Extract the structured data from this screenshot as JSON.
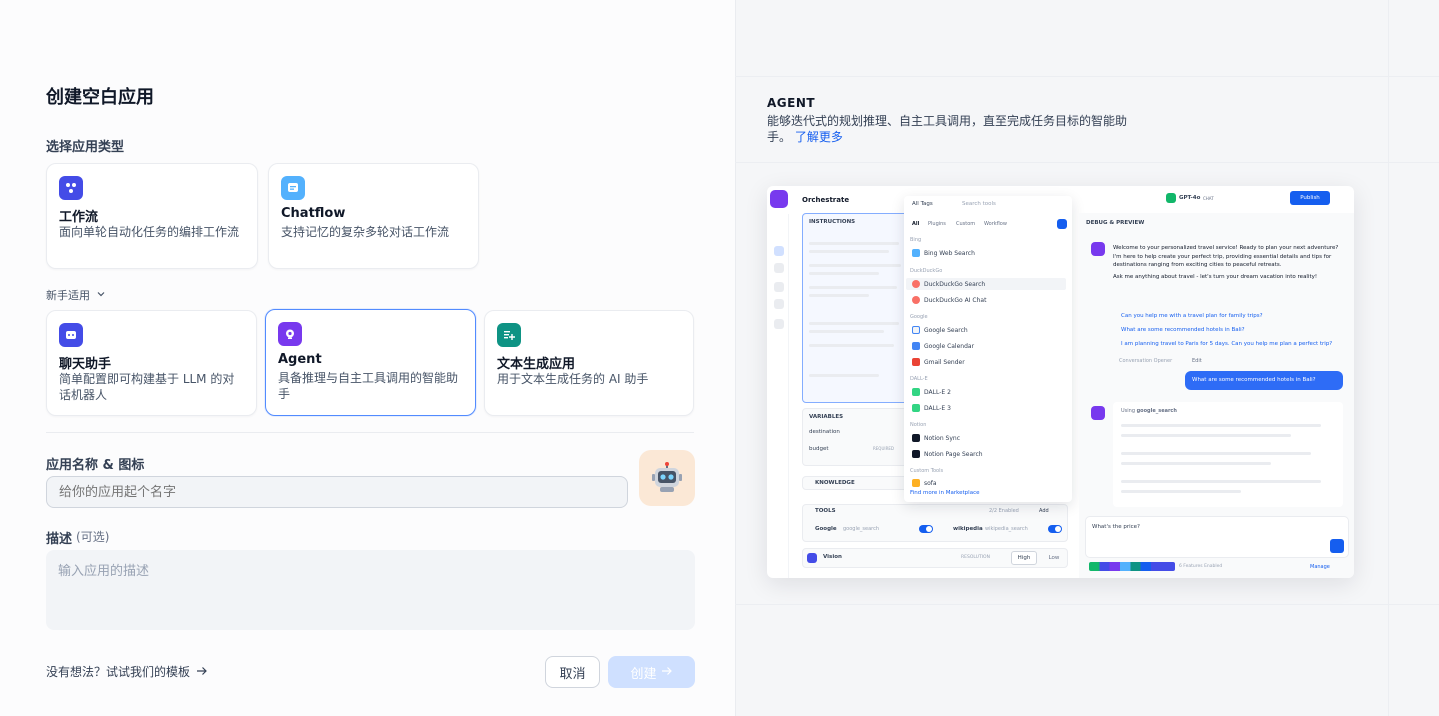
{
  "dialog": {
    "title": "创建空白应用",
    "select_type_label": "选择应用类型",
    "beginner_label": "新手适用",
    "app_types_top": [
      {
        "name": "工作流",
        "desc": "面向单轮自动化任务的编排工作流",
        "icon": "workflow-icon",
        "color": "#444ce7"
      },
      {
        "name": "Chatflow",
        "desc": "支持记忆的复杂多轮对话工作流",
        "icon": "chatflow-icon",
        "color": "#53b1fd"
      }
    ],
    "app_types_beginner": [
      {
        "name": "聊天助手",
        "desc": "简单配置即可构建基于 LLM 的对话机器人",
        "icon": "chatbot-icon",
        "color": "#444ce7"
      },
      {
        "name": "Agent",
        "desc": "具备推理与自主工具调用的智能助手",
        "icon": "agent-icon",
        "color": "#7839ee"
      },
      {
        "name": "文本生成应用",
        "desc": "用于文本生成任务的 AI 助手",
        "icon": "text-generation-icon",
        "color": "#0e9384"
      }
    ],
    "selected": "Agent",
    "name_label": "应用名称 & 图标",
    "name_placeholder": "给你的应用起个名字",
    "desc_label": "描述",
    "desc_optional": "(可选)",
    "desc_placeholder": "输入应用的描述",
    "template_link": "没有想法？试试我们的模板",
    "cancel": "取消",
    "create": "创建"
  },
  "info": {
    "heading": "AGENT",
    "description": "能够迭代式的规划推理、自主工具调用，直至完成任务目标的智能助手。",
    "learn_more": "了解更多"
  },
  "preview": {
    "orchestrate": "Orchestrate",
    "instructions": "INSTRUCTIONS",
    "all_tags": "All Tags",
    "search": "Search tools",
    "tabs": [
      "All",
      "Plugins",
      "Custom",
      "Workflow"
    ],
    "model": "GPT-4o",
    "model_badge": "CHAT",
    "publish": "Publish",
    "debug": "DEBUG & PREVIEW",
    "tool_groups": [
      {
        "category": "Bing",
        "items": [
          "Bing Web Search"
        ]
      },
      {
        "category": "DuckDuckGo",
        "items": [
          "DuckDuckGo Search",
          "DuckDuckGo AI Chat"
        ]
      },
      {
        "category": "Google",
        "items": [
          "Google Search",
          "Google Calendar",
          "Gmail Sender"
        ]
      },
      {
        "category": "DALL-E",
        "items": [
          "DALL-E 2",
          "DALL-E 3"
        ]
      },
      {
        "category": "Notion",
        "items": [
          "Notion Sync",
          "Notion Page Search"
        ]
      },
      {
        "category": "Custom Tools",
        "items": [
          "sofa"
        ]
      }
    ],
    "find_more": "Find more in Marketplace",
    "variables": "VARIABLES",
    "var_destination": "destination",
    "var_budget": "budget",
    "required": "REQUIRED",
    "knowledge": "KNOWLEDGE",
    "tools": "TOOLS",
    "tools_enabled": "2/2 Enabled",
    "add": "Add",
    "tool1": "Google",
    "tool1_sub": "google_search",
    "tool2": "wikipedia",
    "tool2_sub": "wikipedia_search",
    "vision": "Vision",
    "resolution": "RESOLUTION",
    "high": "High",
    "low": "Low",
    "welcome": "Welcome to your personalized travel service! Ready to plan your next adventure? I'm here to help create your perfect trip, providing essential details and tips for destinations ranging from exciting cities to peaceful retreats.",
    "ask": "Ask me anything about travel - let's turn your dream vacation into reality!",
    "suggestions": [
      "Can you help me with a travel plan for family trips?",
      "What are some recommended hotels in Bali?",
      "I am planning travel to Paris for 5 days. Can you help me plan a perfect trip?"
    ],
    "opener": "Conversation Opener",
    "edit": "Edit",
    "user_msg": "What are some recommended hotels in Bali?",
    "using": "Using",
    "using_tool": "google_search",
    "input": "What's the price?",
    "features": "6 Features Enabled",
    "manage": "Manage"
  },
  "colors": {
    "accent": "#155eef",
    "selected_border": "#528bff",
    "create_disabled": "#cfe0ff"
  }
}
